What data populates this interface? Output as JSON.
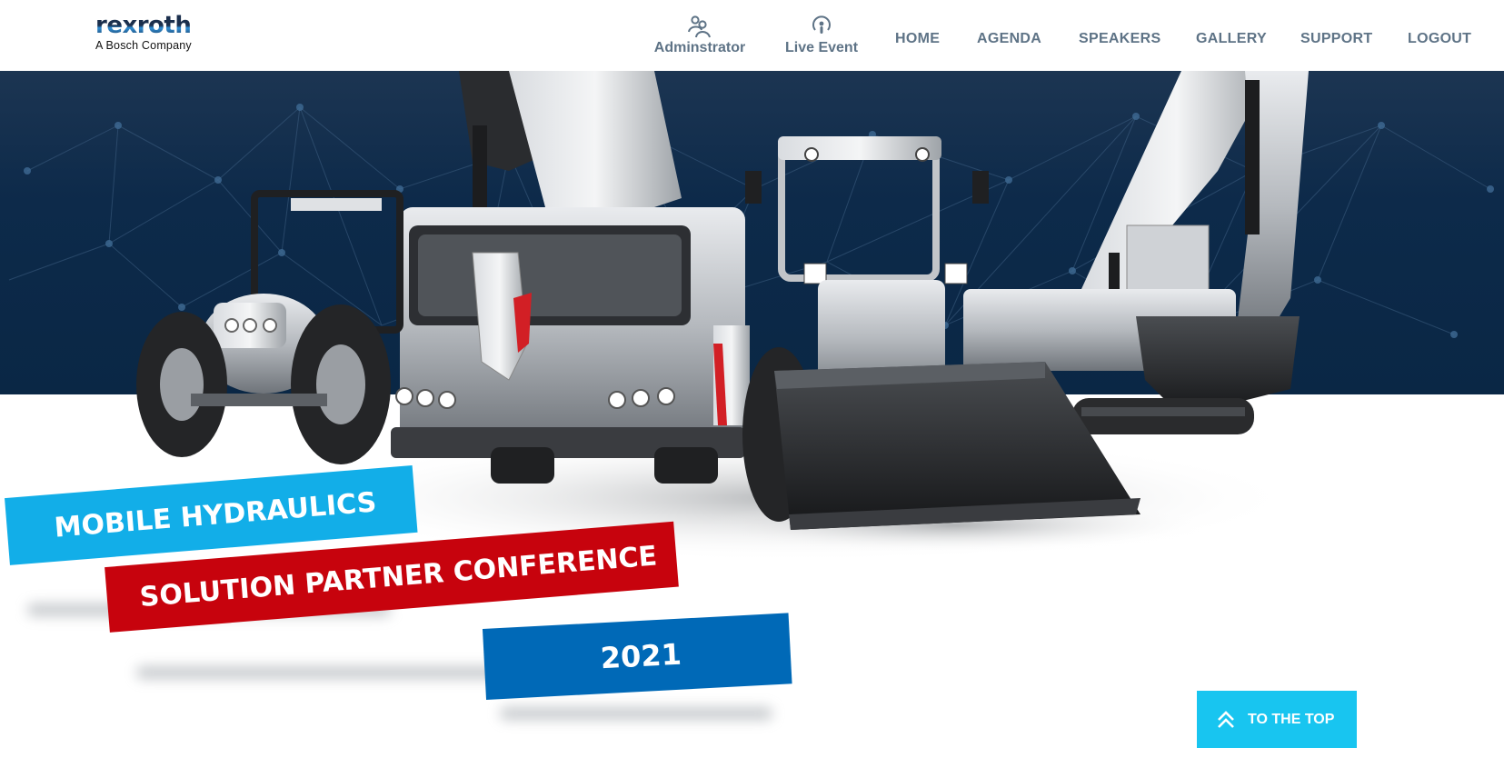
{
  "header": {
    "logo_word": "rexroth",
    "logo_sub": "A Bosch Company",
    "nav": {
      "administrator": {
        "label": "Adminstrator",
        "icon": "users-icon"
      },
      "live_event": {
        "label": "Live Event",
        "icon": "podcast-icon"
      },
      "home": "HOME",
      "agenda": "AGENDA",
      "speakers": "SPEAKERS",
      "gallery": "GALLERY",
      "support": "SUPPORT",
      "logout": "LOGOUT"
    }
  },
  "hero": {
    "banner_line_1": "MOBILE HYDRAULICS",
    "banner_line_2": "SOLUTION PARTNER CONFERENCE",
    "banner_line_3": "2021",
    "vehicles": [
      "tractor",
      "mobile-crane",
      "wheel-loader",
      "excavator"
    ]
  },
  "to_top": {
    "label": "TO THE TOP",
    "icon": "double-chevron-up-icon"
  },
  "colors": {
    "nav_text": "#5e7386",
    "hero_band": "#0a2745",
    "banner_blue_light": "#12aee8",
    "banner_red": "#c7030d",
    "banner_blue": "#0069b7",
    "to_top_bg": "#18c5f0"
  }
}
